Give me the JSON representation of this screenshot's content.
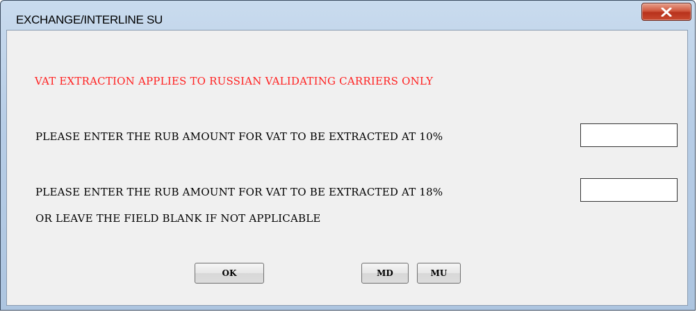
{
  "window": {
    "title": "EXCHANGE/INTERLINE SU",
    "close_icon": "close-x-icon"
  },
  "dialog": {
    "warning": "VAT EXTRACTION APPLIES TO RUSSIAN VALIDATING CARRIERS ONLY",
    "prompt_10": "PLEASE ENTER THE RUB AMOUNT FOR VAT TO BE EXTRACTED AT 10%",
    "prompt_18": "PLEASE ENTER THE RUB AMOUNT FOR VAT TO BE EXTRACTED AT 18%",
    "prompt_18_note": "OR LEAVE THE FIELD BLANK IF NOT APPLICABLE",
    "vat_10_value": "",
    "vat_18_value": ""
  },
  "buttons": {
    "ok_label": "OK",
    "md_label": "MD",
    "mu_label": "MU"
  },
  "colors": {
    "warning": "#ff2020",
    "client_bg": "#f0f0f0",
    "close_button": "#c8492f"
  }
}
